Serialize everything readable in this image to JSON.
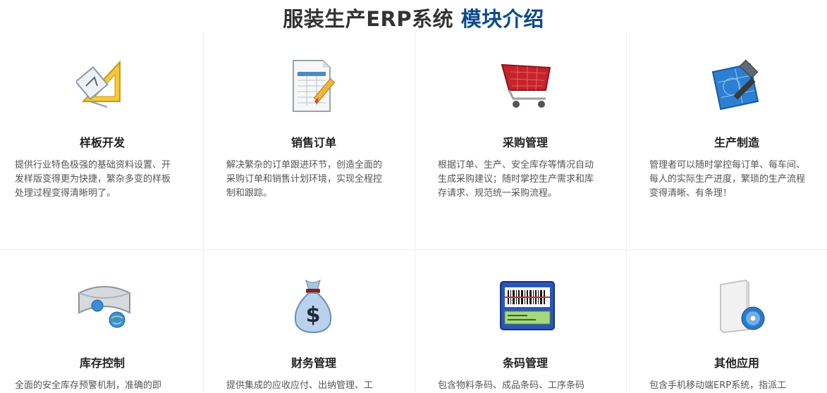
{
  "header": {
    "title_main": "服装生产ERP系统",
    "title_accent": "模块介绍"
  },
  "modules": [
    {
      "title": "样板开发",
      "desc": "提供行业特色极强的基础资料设置、开发样版变得更为快捷，繁杂多变的样板处理过程变得清晰明了。",
      "icon": "drafting-triangle-icon"
    },
    {
      "title": "销售订单",
      "desc": "解决繁杂的订单跟进环节，创造全面的采购订单和销售计划环境，实现全程控制和跟踪。",
      "icon": "spreadsheet-pencil-icon"
    },
    {
      "title": "采购管理",
      "desc": "根据订单、生产、安全库存等情况自动生成采购建议；随时掌控生产需求和库存请求、规范统一采购流程。",
      "icon": "shopping-cart-icon"
    },
    {
      "title": "生产制造",
      "desc": "管理者可以随时掌控每订单、每车间、每人的实际生产进度，繁琐的生产流程变得清晰、有条理！",
      "icon": "hammer-blueprint-icon"
    },
    {
      "title": "库存控制",
      "desc": "全面的安全库存预警机制，准确的即",
      "icon": "pipe-globe-icon"
    },
    {
      "title": "财务管理",
      "desc": "提供集成的应收应付、出纳管理、工",
      "icon": "money-bag-icon"
    },
    {
      "title": "条码管理",
      "desc": "包含物料条码、成品条码、工序条码",
      "icon": "barcode-scanner-icon"
    },
    {
      "title": "其他应用",
      "desc": "包含手机移动端ERP系统，指派工",
      "icon": "software-box-cd-icon"
    }
  ]
}
